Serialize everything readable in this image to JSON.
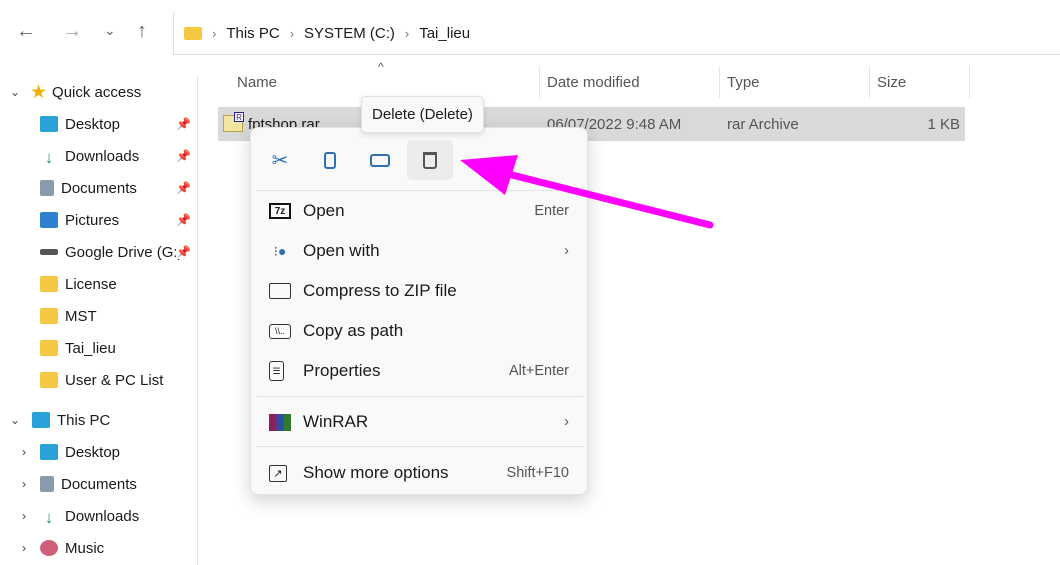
{
  "nav": {
    "back": "←",
    "forward": "→",
    "recent": "⌄",
    "up": "↑"
  },
  "breadcrumb": [
    "This PC",
    "SYSTEM (C:)",
    "Tai_lieu"
  ],
  "sidebar": {
    "quick_access": "Quick access",
    "quick_items": [
      {
        "label": "Desktop",
        "pinned": true
      },
      {
        "label": "Downloads",
        "pinned": true
      },
      {
        "label": "Documents",
        "pinned": true
      },
      {
        "label": "Pictures",
        "pinned": true
      },
      {
        "label": "Google Drive (G:)",
        "pinned": true
      },
      {
        "label": "License"
      },
      {
        "label": "MST"
      },
      {
        "label": "Tai_lieu"
      },
      {
        "label": "User & PC List"
      }
    ],
    "this_pc": "This PC",
    "pc_items": [
      "Desktop",
      "Documents",
      "Downloads",
      "Music"
    ]
  },
  "columns": {
    "name": "Name",
    "date": "Date modified",
    "type": "Type",
    "size": "Size"
  },
  "file": {
    "name": "fptshop.rar",
    "date": "06/07/2022 9:48 AM",
    "type": "rar Archive",
    "size": "1 KB"
  },
  "tooltip": "Delete (Delete)",
  "menu": {
    "items": [
      {
        "label": "Open",
        "shortcut": "Enter"
      },
      {
        "label": "Open with",
        "submenu": true
      },
      {
        "label": "Compress to ZIP file"
      },
      {
        "label": "Copy as path"
      },
      {
        "label": "Properties",
        "shortcut": "Alt+Enter"
      }
    ],
    "winrar": "WinRAR",
    "more": {
      "label": "Show more options",
      "shortcut": "Shift+F10"
    }
  },
  "colors": {
    "arrow": "#ff00ff",
    "accent": "#2f6fb3",
    "selection": "#d9d9d9"
  }
}
